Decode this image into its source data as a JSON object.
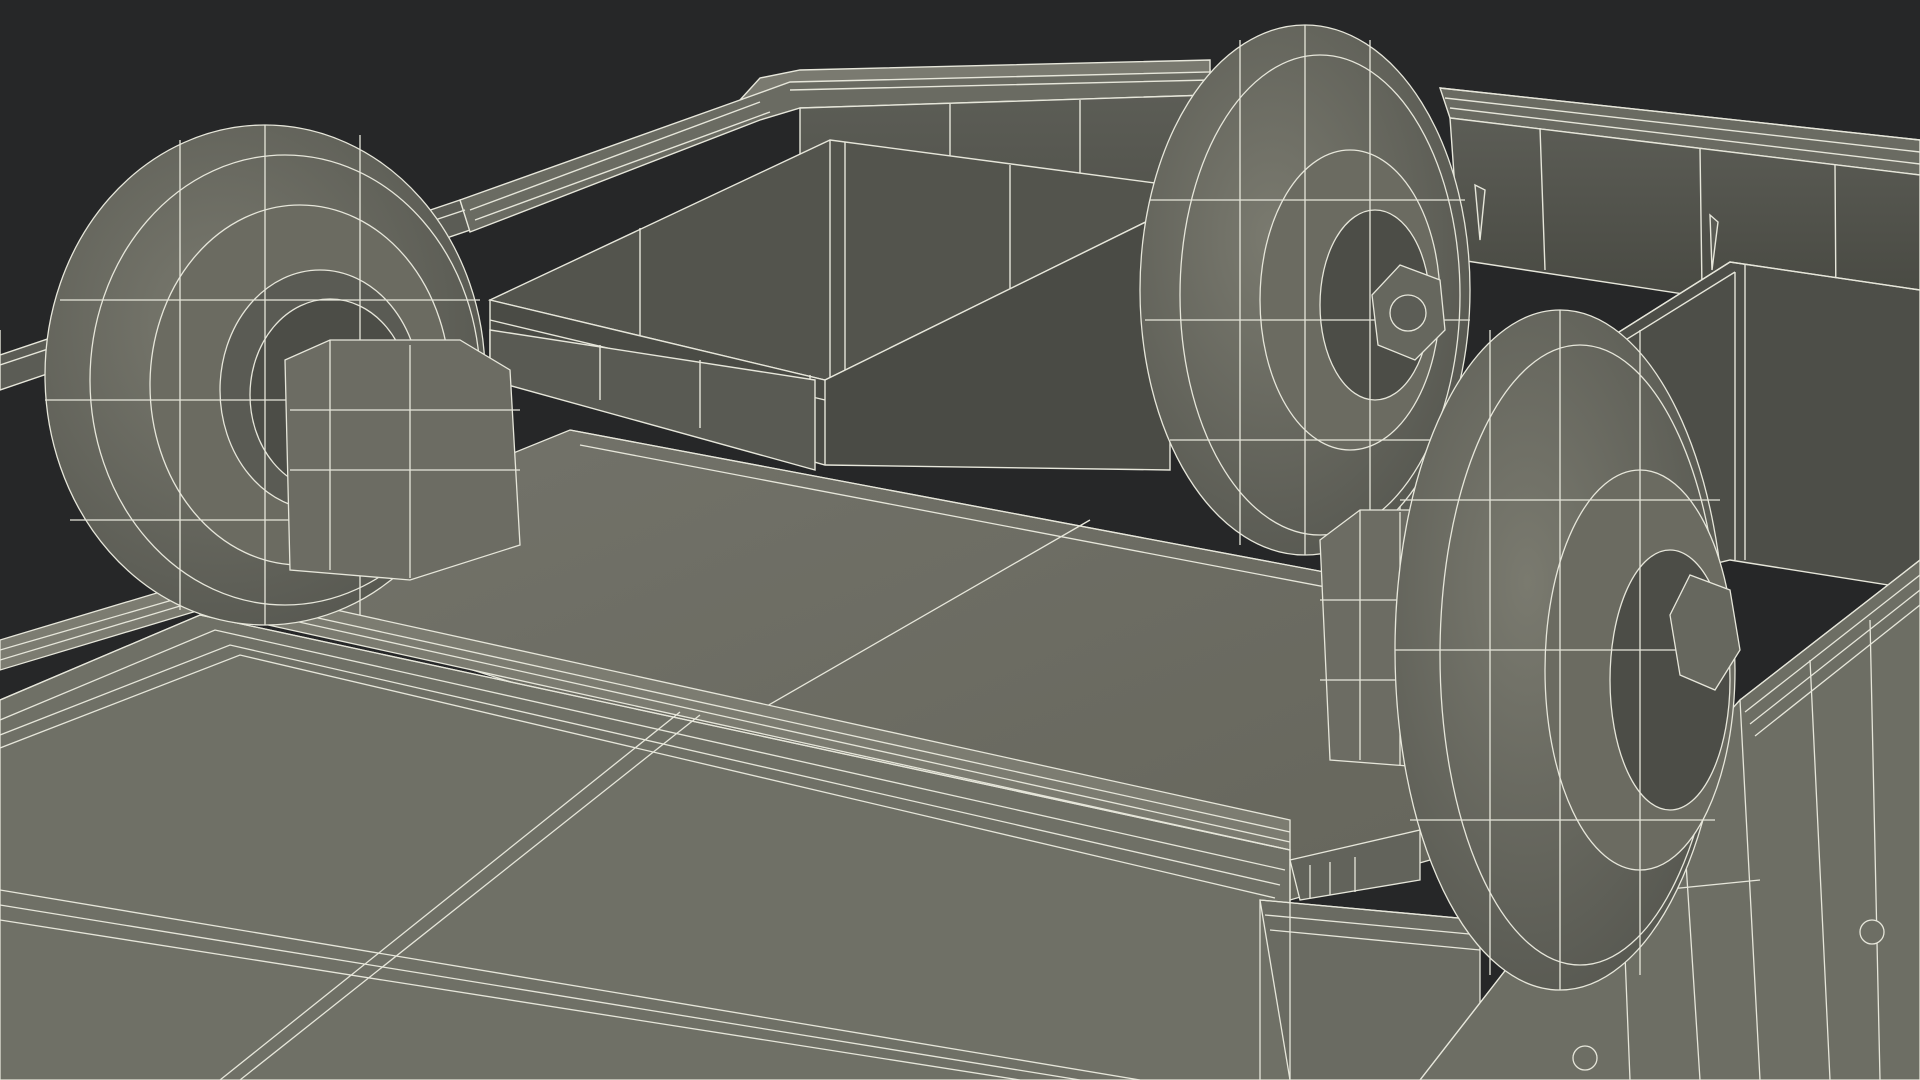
{
  "scene": {
    "subject": "wireframe-render-wheeled-cart",
    "colors": {
      "background": "#262728",
      "surface": "#717166",
      "surface_light": "#7c7c71",
      "surface_dark": "#4f504a",
      "shadow": "#3a3b37",
      "wire": "#e6e6da"
    },
    "objects": [
      "cart-frame",
      "rear-box-compartment",
      "left-wheel",
      "center-wheel",
      "right-wheel",
      "front-deck-plate",
      "front-step-plate",
      "right-side-rail"
    ]
  }
}
